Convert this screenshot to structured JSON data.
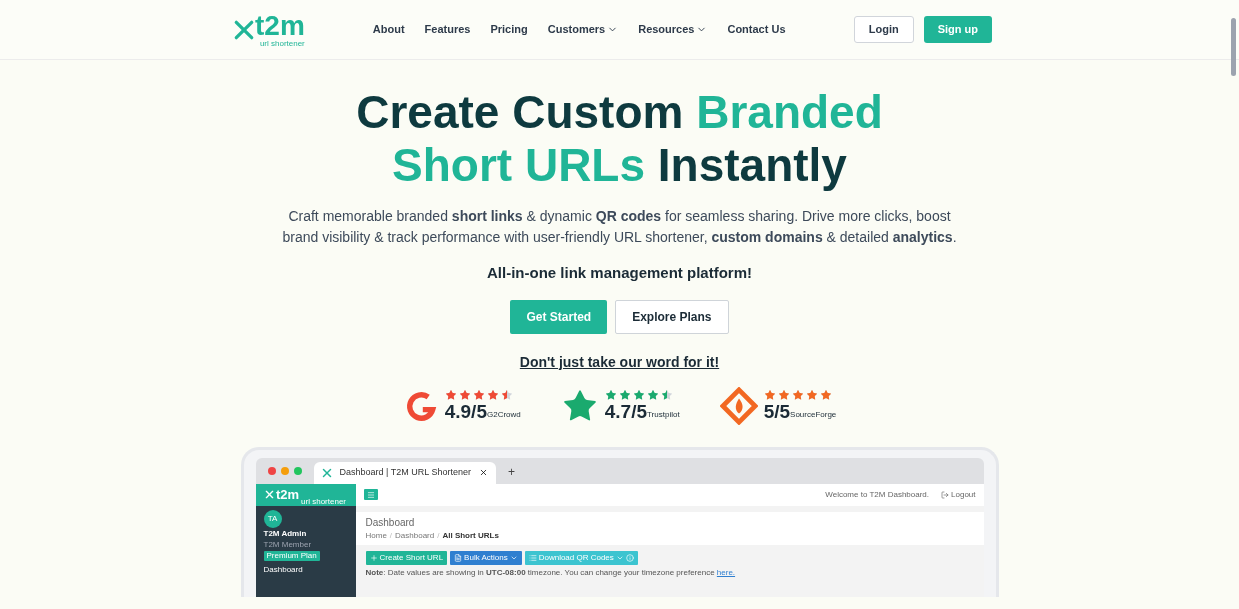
{
  "nav": {
    "logo": {
      "text": "t2m",
      "tagline": "url shortener"
    },
    "links": [
      {
        "label": "About",
        "dropdown": false
      },
      {
        "label": "Features",
        "dropdown": false
      },
      {
        "label": "Pricing",
        "dropdown": false
      },
      {
        "label": "Customers",
        "dropdown": true
      },
      {
        "label": "Resources",
        "dropdown": true
      },
      {
        "label": "Contact Us",
        "dropdown": false
      }
    ],
    "login": "Login",
    "signup": "Sign up"
  },
  "hero": {
    "title_parts": [
      {
        "text": "Create Custom ",
        "accent": false
      },
      {
        "text": "Branded",
        "accent": true
      },
      {
        "text": "Short URLs",
        "accent": true
      },
      {
        "text": " Instantly",
        "accent": false
      }
    ],
    "description": "Craft memorable branded **short links** & dynamic **QR codes** for seamless sharing. Drive more clicks, boost brand visibility & track performance with user-friendly URL shortener, **custom domains** & detailed **analytics**.",
    "tagline": "All-in-one link management platform!",
    "primary_button": "Get Started",
    "secondary_button": "Explore Plans",
    "proof_link": "Don't just take our word for it!"
  },
  "ratings": [
    {
      "kind": "g2",
      "stars": 4.5,
      "score": "4.9/5",
      "source": "G2Crowd"
    },
    {
      "kind": "trustpilot",
      "stars": 4.5,
      "score": "4.7/5",
      "source": "Trustpilot"
    },
    {
      "kind": "sourceforge",
      "stars": 5,
      "score": "5/5",
      "source": "SourceForge"
    }
  ],
  "dashboard": {
    "tab_title": "Dashboard | T2M URL Shortener",
    "new_tab": "+",
    "logo": "t2m",
    "logo_tagline": "url shortener",
    "avatar": "TA",
    "user_name": "T2M Admin",
    "user_role": "T2M Member",
    "plan": "Premium Plan",
    "nav_item": "Dashboard",
    "welcome": "Welcome to T2M Dashboard.",
    "logout": "Logout",
    "page_title": "Dashboard",
    "breadcrumb_separator": "/",
    "breadcrumbs": [
      {
        "label": "Home",
        "current": false
      },
      {
        "label": "Dashboard",
        "current": false
      },
      {
        "label": "All Short URLs",
        "current": true
      }
    ],
    "actions": [
      {
        "label": "Create Short URL",
        "color": "#20b597"
      },
      {
        "label": "Bulk Actions",
        "color": "#2f7fd0"
      },
      {
        "label": "Download QR Codes",
        "color": "#3cc4d0"
      }
    ],
    "note": "**Note**: Date values are showing in **UTC-08:00** timezone. You can change your timezone preference",
    "note_link": "here."
  }
}
